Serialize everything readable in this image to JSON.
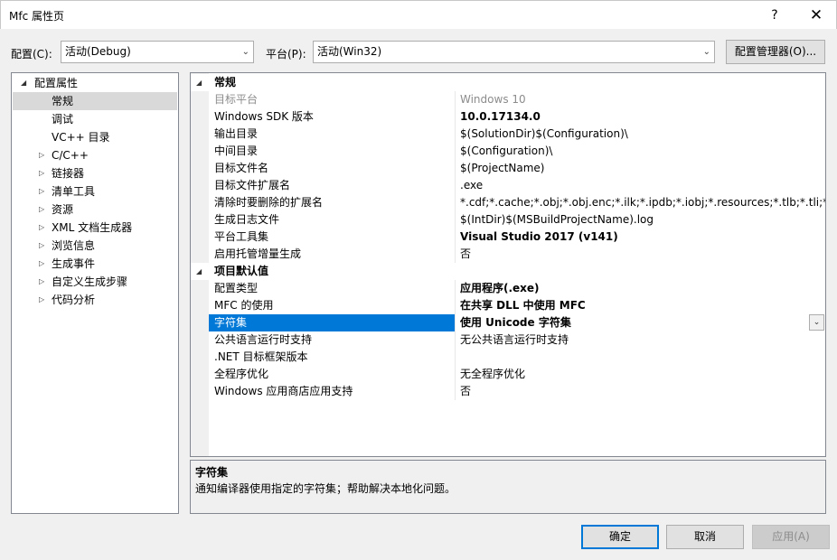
{
  "window": {
    "title": "Mfc 属性页",
    "help_label": "?",
    "close_label": "✕"
  },
  "toolbar": {
    "config_label": "配置(C):",
    "config_value": "活动(Debug)",
    "platform_label": "平台(P):",
    "platform_value": "活动(Win32)",
    "config_manager_label": "配置管理器(O)..."
  },
  "tree": {
    "root": "配置属性",
    "items": [
      {
        "label": "常规",
        "selected": true,
        "expandable": false
      },
      {
        "label": "调试",
        "expandable": false
      },
      {
        "label": "VC++ 目录",
        "expandable": false
      },
      {
        "label": "C/C++",
        "expandable": true
      },
      {
        "label": "链接器",
        "expandable": true
      },
      {
        "label": "清单工具",
        "expandable": true
      },
      {
        "label": "资源",
        "expandable": true
      },
      {
        "label": "XML 文档生成器",
        "expandable": true
      },
      {
        "label": "浏览信息",
        "expandable": true
      },
      {
        "label": "生成事件",
        "expandable": true
      },
      {
        "label": "自定义生成步骤",
        "expandable": true
      },
      {
        "label": "代码分析",
        "expandable": true
      }
    ]
  },
  "grid": {
    "categories": [
      {
        "name": "常规",
        "rows": [
          {
            "name": "目标平台",
            "value": "Windows 10",
            "disabled": true
          },
          {
            "name": "Windows SDK 版本",
            "value": "10.0.17134.0",
            "bold": true
          },
          {
            "name": "输出目录",
            "value": "$(SolutionDir)$(Configuration)\\"
          },
          {
            "name": "中间目录",
            "value": "$(Configuration)\\"
          },
          {
            "name": "目标文件名",
            "value": "$(ProjectName)"
          },
          {
            "name": "目标文件扩展名",
            "value": ".exe"
          },
          {
            "name": "清除时要删除的扩展名",
            "value": "*.cdf;*.cache;*.obj;*.obj.enc;*.ilk;*.ipdb;*.iobj;*.resources;*.tlb;*.tli;*.tlh;*.tmp;*.rsp;*.pgc;*.pgd;*.meta;*.tlog;*.manifest;*.res;*.pch;*.exp;*.idb;*.rep;*.xdc;*.pdb;*_manifest.rc;*.bsc;*.sbr;*.xml;*.metagen;*.bi"
          },
          {
            "name": "生成日志文件",
            "value": "$(IntDir)$(MSBuildProjectName).log"
          },
          {
            "name": "平台工具集",
            "value": "Visual Studio 2017 (v141)",
            "bold": true
          },
          {
            "name": "启用托管增量生成",
            "value": "否"
          }
        ]
      },
      {
        "name": "项目默认值",
        "rows": [
          {
            "name": "配置类型",
            "value": "应用程序(.exe)",
            "bold": true
          },
          {
            "name": "MFC 的使用",
            "value": "在共享 DLL 中使用 MFC",
            "bold": true
          },
          {
            "name": "字符集",
            "value": "使用 Unicode 字符集",
            "bold": true,
            "selected": true
          },
          {
            "name": "公共语言运行时支持",
            "value": "无公共语言运行时支持"
          },
          {
            "name": ".NET 目标框架版本",
            "value": ""
          },
          {
            "name": "全程序优化",
            "value": "无全程序优化"
          },
          {
            "name": "Windows 应用商店应用支持",
            "value": "否"
          }
        ]
      }
    ]
  },
  "description": {
    "title": "字符集",
    "text": "通知编译器使用指定的字符集；帮助解决本地化问题。"
  },
  "buttons": {
    "ok": "确定",
    "cancel": "取消",
    "apply": "应用(A)"
  },
  "colors": {
    "selection": "#0078d7",
    "tree_selection": "#d9d9d9",
    "disabled_text": "#8c8c8c"
  }
}
